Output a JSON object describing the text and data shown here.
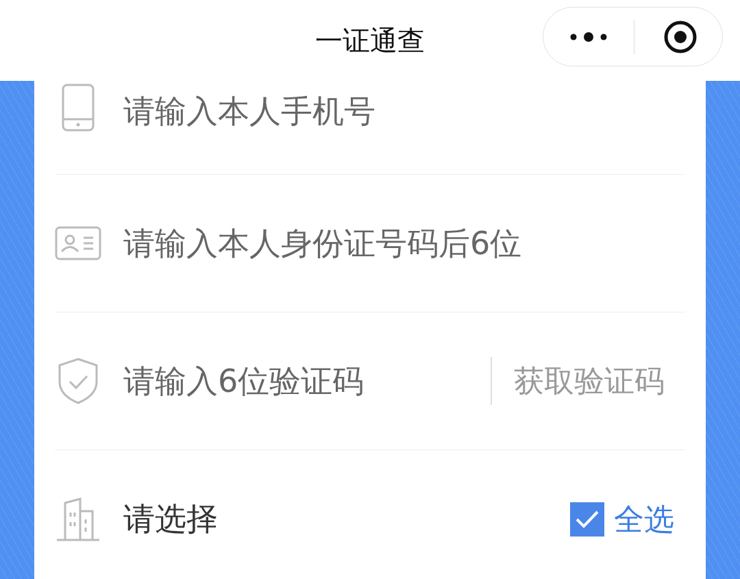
{
  "header": {
    "title": "一证通查"
  },
  "fields": [
    {
      "kind": "phone",
      "placeholder": "请输入本人手机号"
    },
    {
      "kind": "id",
      "placeholder": "请输入本人身份证号码后6位"
    },
    {
      "kind": "code",
      "placeholder": "请输入6位验证码",
      "action": "获取验证码"
    }
  ],
  "select": {
    "label": "请选择",
    "select_all": {
      "label": "全选",
      "checked": true
    }
  }
}
